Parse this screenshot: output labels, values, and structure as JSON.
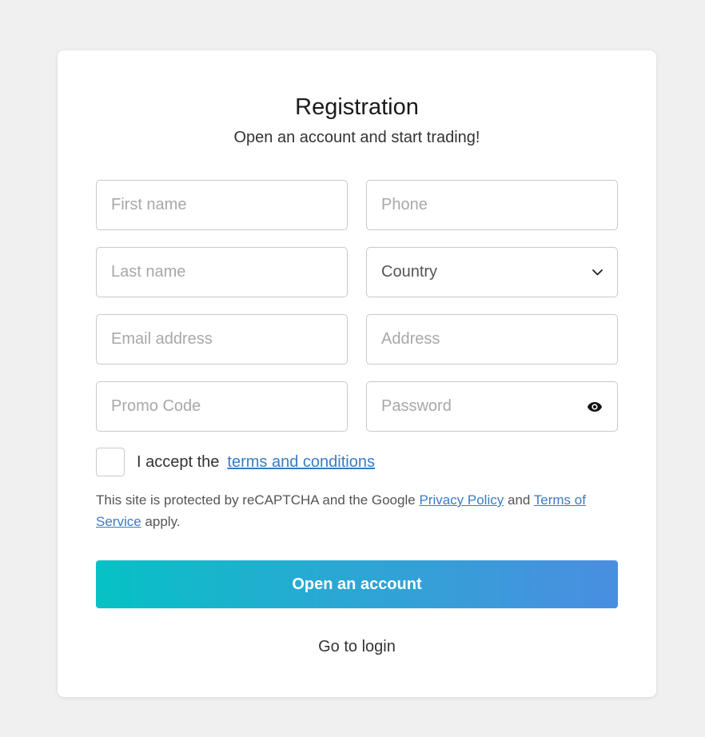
{
  "header": {
    "title": "Registration",
    "subtitle": "Open an account and start trading!"
  },
  "form": {
    "first_name": {
      "placeholder": "First name",
      "value": ""
    },
    "phone": {
      "placeholder": "Phone",
      "value": ""
    },
    "last_name": {
      "placeholder": "Last name",
      "value": ""
    },
    "country": {
      "selected": "Country",
      "icon": "chevron-down-icon"
    },
    "email": {
      "placeholder": "Email address",
      "value": ""
    },
    "address": {
      "placeholder": "Address",
      "value": ""
    },
    "promo_code": {
      "placeholder": "Promo Code",
      "value": ""
    },
    "password": {
      "placeholder": "Password",
      "value": "",
      "icon": "eye-icon"
    }
  },
  "terms": {
    "prefix": "I accept the",
    "link": "terms and conditions",
    "checked": false
  },
  "recaptcha": {
    "text_1": "This site is protected by reCAPTCHA and the Google",
    "privacy_link": "Privacy Policy",
    "text_2": "and",
    "terms_link": "Terms of Service",
    "text_3": "apply."
  },
  "actions": {
    "submit_label": "Open an account",
    "login_label": "Go to login"
  },
  "colors": {
    "gradient_start": "#05c2c5",
    "gradient_end": "#4a8ee0",
    "link": "#3a7cc2"
  }
}
